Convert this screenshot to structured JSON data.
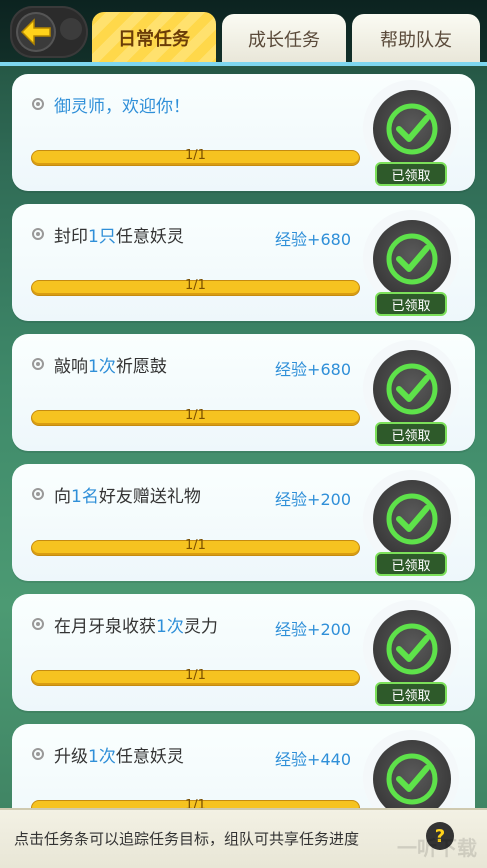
{
  "tabs": [
    {
      "label": "日常任务"
    },
    {
      "label": "成长任务"
    },
    {
      "label": "帮助队友"
    }
  ],
  "tasks": [
    {
      "title_parts": [
        {
          "t": "御灵师，欢迎你！",
          "hl": false
        }
      ],
      "title_color": "blue",
      "reward": "",
      "progress": "1/1",
      "status": "已领取"
    },
    {
      "title_parts": [
        {
          "t": "封印",
          "hl": false
        },
        {
          "t": "1只",
          "hl": true
        },
        {
          "t": "任意妖灵",
          "hl": false
        }
      ],
      "title_color": "default",
      "reward": "经验+680",
      "progress": "1/1",
      "status": "已领取"
    },
    {
      "title_parts": [
        {
          "t": "敲响",
          "hl": false
        },
        {
          "t": "1次",
          "hl": true
        },
        {
          "t": "祈愿鼓",
          "hl": false
        }
      ],
      "title_color": "default",
      "reward": "经验+680",
      "progress": "1/1",
      "status": "已领取"
    },
    {
      "title_parts": [
        {
          "t": "向",
          "hl": false
        },
        {
          "t": "1名",
          "hl": true
        },
        {
          "t": "好友赠送礼物",
          "hl": false
        }
      ],
      "title_color": "default",
      "reward": "经验+200",
      "progress": "1/1",
      "status": "已领取"
    },
    {
      "title_parts": [
        {
          "t": "在月牙泉收获",
          "hl": false
        },
        {
          "t": "1次",
          "hl": true
        },
        {
          "t": "灵力",
          "hl": false
        }
      ],
      "title_color": "default",
      "reward": "经验+200",
      "progress": "1/1",
      "status": "已领取"
    },
    {
      "title_parts": [
        {
          "t": "升级",
          "hl": false
        },
        {
          "t": "1次",
          "hl": true
        },
        {
          "t": "任意妖灵",
          "hl": false
        }
      ],
      "title_color": "default",
      "reward": "经验+440",
      "progress": "1/1",
      "status": "已领取"
    }
  ],
  "footer": {
    "tip": "点击任务条可以追踪任务目标，组队可共享任务进度",
    "help_label": "?",
    "watermark": "一听下载"
  },
  "icons": {
    "back": "arrow-left-icon",
    "check": "check-circle-icon",
    "help": "question-icon"
  },
  "colors": {
    "accent_blue": "#2f8fd8",
    "progress": "#f6c320",
    "tab_active": "#ffd84a",
    "check_green": "#5ee24a"
  }
}
